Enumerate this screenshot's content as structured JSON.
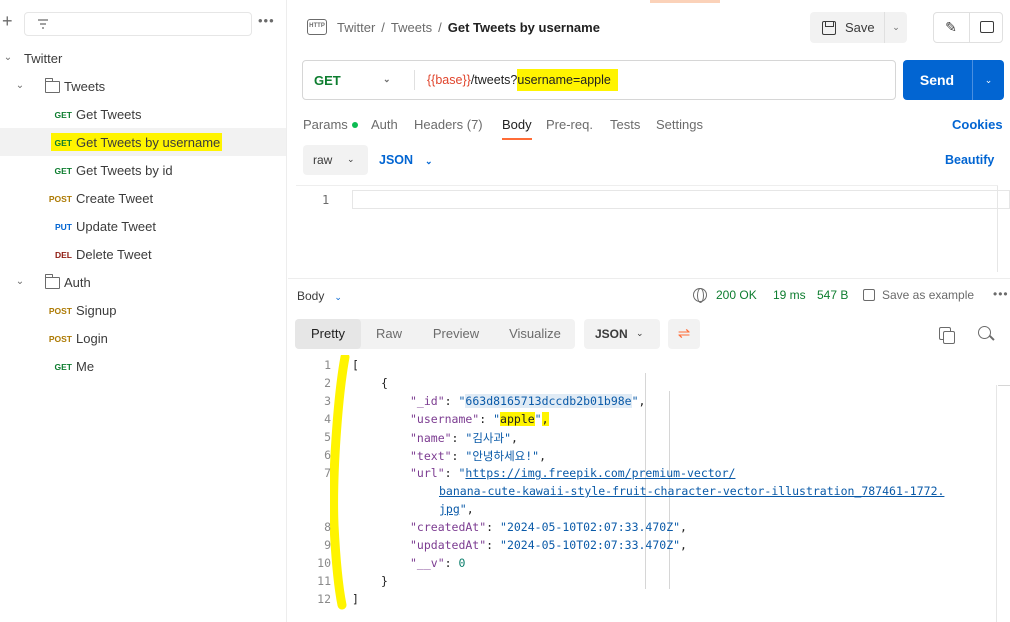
{
  "sidebar": {
    "collection": "Twitter",
    "folders": [
      {
        "name": "Tweets"
      },
      {
        "name": "Auth"
      }
    ],
    "requests": [
      {
        "method": "GET",
        "name": "Get Tweets"
      },
      {
        "method": "GET",
        "name": "Get Tweets by username"
      },
      {
        "method": "GET",
        "name": "Get Tweets by id"
      },
      {
        "method": "POST",
        "name": "Create Tweet"
      },
      {
        "method": "PUT",
        "name": "Update Tweet"
      },
      {
        "method": "DEL",
        "name": "Delete Tweet"
      },
      {
        "method": "POST",
        "name": "Signup"
      },
      {
        "method": "POST",
        "name": "Login"
      },
      {
        "method": "GET",
        "name": "Me"
      }
    ],
    "more": "•••"
  },
  "header": {
    "http_icon": "HTTP",
    "breadcrumb": [
      "Twitter",
      "Tweets",
      "Get Tweets by username"
    ],
    "separator": "/",
    "save_label": "Save"
  },
  "request": {
    "method": "GET",
    "url_var": "{{base}}",
    "url_path": "/tweets?",
    "url_query": "username=apple",
    "send_label": "Send",
    "tabs": [
      "Params",
      "Auth",
      "Headers (7)",
      "Body",
      "Pre-req.",
      "Tests",
      "Settings"
    ],
    "active_tab": "Body",
    "cookies_label": "Cookies",
    "body_type": "raw",
    "body_lang": "JSON",
    "beautify_label": "Beautify",
    "editor_line": "1"
  },
  "response": {
    "label": "Body",
    "status": "200 OK",
    "time": "19 ms",
    "size": "547 B",
    "save_example": "Save as example",
    "views": [
      "Pretty",
      "Raw",
      "Preview",
      "Visualize"
    ],
    "active_view": "Pretty",
    "format": "JSON",
    "line_numbers": [
      "1",
      "2",
      "3",
      "4",
      "5",
      "6",
      "7",
      "",
      "8",
      "9",
      "10",
      "11",
      "12"
    ],
    "json": {
      "open_bracket": "[",
      "open_brace": "{",
      "id_key": "\"_id\"",
      "id_val": "663d8165713dccdb2b01b98e",
      "username_key": "\"username\"",
      "username_val": "apple",
      "name_key": "\"name\"",
      "name_val": "\"김사과\"",
      "text_key": "\"text\"",
      "text_val": "\"안녕하세요!\"",
      "url_key": "\"url\"",
      "url_part1": "https://img.freepik.com/premium-vector/",
      "url_part2": "banana-cute-kawaii-style-fruit-character-vector-illustration_787461-1772.",
      "url_part3": "jpg",
      "createdAt_key": "\"createdAt\"",
      "createdAt_val": "\"2024-05-10T02:07:33.470Z\"",
      "updatedAt_key": "\"updatedAt\"",
      "updatedAt_val": "\"2024-05-10T02:07:33.470Z\"",
      "v_key": "\"__v\"",
      "v_val": "0",
      "close_brace": "}",
      "close_bracket": "]"
    }
  },
  "colors": {
    "get": "#0d7d2f",
    "post": "#ad7a03",
    "put": "#0265d2",
    "del": "#8e1a10",
    "send": "#0265d2",
    "highlight": "#fff400",
    "accent": "#ff6c37"
  },
  "icons": [
    "plus-icon",
    "filter-icon",
    "more-icon",
    "chevron-down-icon",
    "folder-icon",
    "http-icon",
    "save-icon",
    "pencil-icon",
    "comment-icon",
    "globe-icon",
    "copy-icon",
    "search-icon",
    "wrap-icon"
  ]
}
